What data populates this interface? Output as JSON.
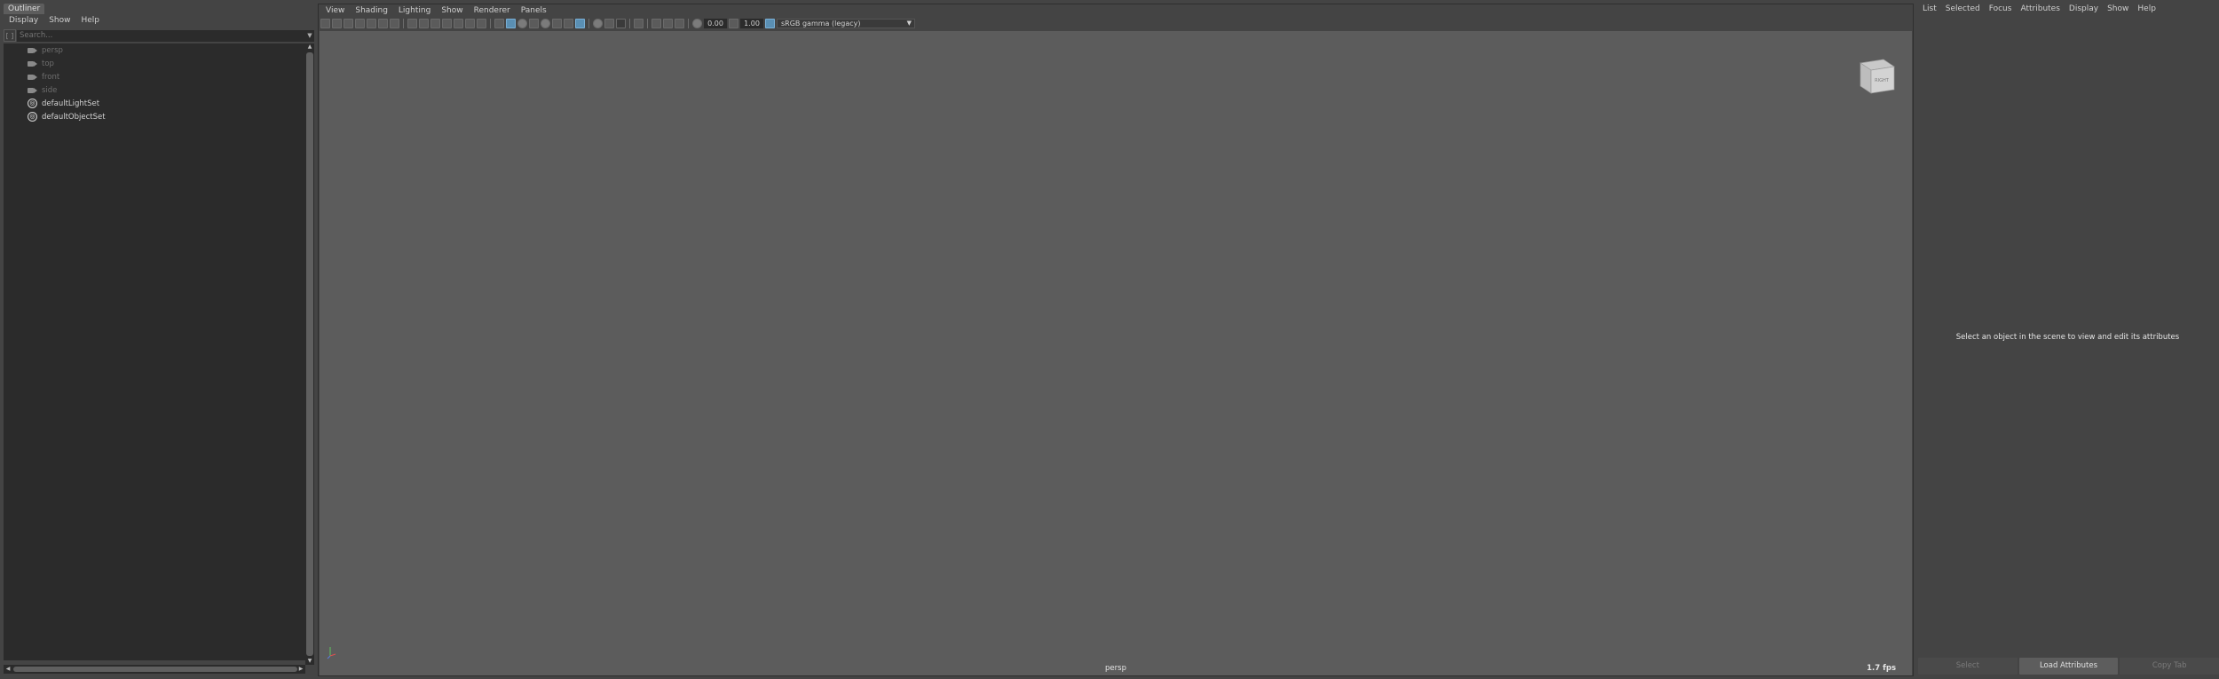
{
  "outliner": {
    "tab": "Outliner",
    "menu": [
      "Display",
      "Show",
      "Help"
    ],
    "search_placeholder": "Search...",
    "items": [
      {
        "label": "persp",
        "icon": "camera-icon",
        "dim": true
      },
      {
        "label": "top",
        "icon": "camera-icon",
        "dim": true
      },
      {
        "label": "front",
        "icon": "camera-icon",
        "dim": true
      },
      {
        "label": "side",
        "icon": "camera-icon",
        "dim": true
      },
      {
        "label": "defaultLightSet",
        "icon": "object-set-icon",
        "dim": false
      },
      {
        "label": "defaultObjectSet",
        "icon": "object-set-icon",
        "dim": false
      }
    ]
  },
  "viewport": {
    "menu": [
      "View",
      "Shading",
      "Lighting",
      "Show",
      "Renderer",
      "Panels"
    ],
    "exposure_value": "0.00",
    "gamma_value": "1.00",
    "color_space": "sRGB gamma (legacy)",
    "viewcube_label": "RIGHT",
    "camera_name": "persp",
    "fps": "1.7 fps"
  },
  "attribute_editor": {
    "menu": [
      "List",
      "Selected",
      "Focus",
      "Attributes",
      "Display",
      "Show",
      "Help"
    ],
    "message": "Select an object in the scene to view and edit its attributes",
    "buttons": {
      "select": "Select",
      "load": "Load Attributes",
      "copy": "Copy Tab"
    }
  },
  "colors": {
    "panel_bg": "#444444",
    "viewport_bg": "#5c5c5c",
    "list_bg": "#2b2b2b",
    "active_accent": "#5a8fb3"
  }
}
